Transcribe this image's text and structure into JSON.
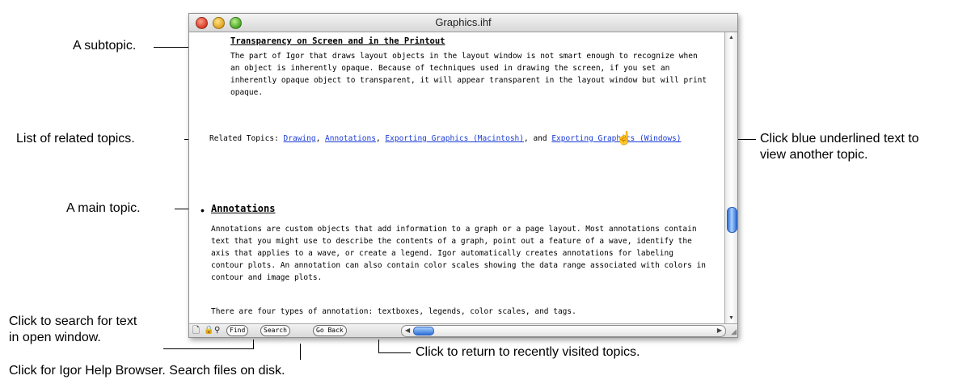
{
  "window": {
    "title": "Graphics.ihf",
    "subtopic": "Transparency on Screen and in the Printout",
    "paragraph1": "The part of Igor that draws layout objects in the layout window is not smart enough to recognize when an object is inherently opaque. Because of techniques used in drawing the screen, if you set an inherently opaque object to transparent, it will appear transparent in the layout window but will print opaque.",
    "related_label": "Related Topics:",
    "related_links": [
      "Drawing",
      "Annotations",
      "Exporting Graphics (Macintosh)",
      "Exporting Graphics (Windows)"
    ],
    "related_sep1": ", ",
    "related_sep2": ", ",
    "related_and": ", and ",
    "bullet": "•",
    "main_topic": "Annotations",
    "paragraph2": "Annotations are custom objects that add information to a graph or a page layout. Most annotations contain text that you might use to describe the contents of a graph, point out a feature of a wave, identify the axis that applies to a wave, or create a legend. Igor automatically creates annotations for labeling contour plots. An annotation can also contain color scales showing the data range associated with colors in contour and image plots.",
    "paragraph3": "There are four types of annotation: textboxes, legends, color scales, and tags.",
    "status_buttons": {
      "find": "Find",
      "search": "Search",
      "go_back": "Go Back"
    },
    "icons": [
      "document-icon",
      "lock-icon",
      "magnifier-icon",
      "hand-pointer-icon"
    ]
  },
  "callouts": {
    "subtopic": "A subtopic.",
    "related": "List of related topics.",
    "main_topic": "A main topic.",
    "search_text_line1": "Click to search for text",
    "search_text_line2": "in open window.",
    "browser": "Click for Igor Help Browser. Search files on disk.",
    "go_back": "Click to return to recently visited topics.",
    "blue_text_line1": "Click blue underlined text to",
    "blue_text_line2": "view another topic."
  },
  "colors": {
    "link": "#1a3cd6",
    "scroll_thumb": "#2c6fd6"
  }
}
